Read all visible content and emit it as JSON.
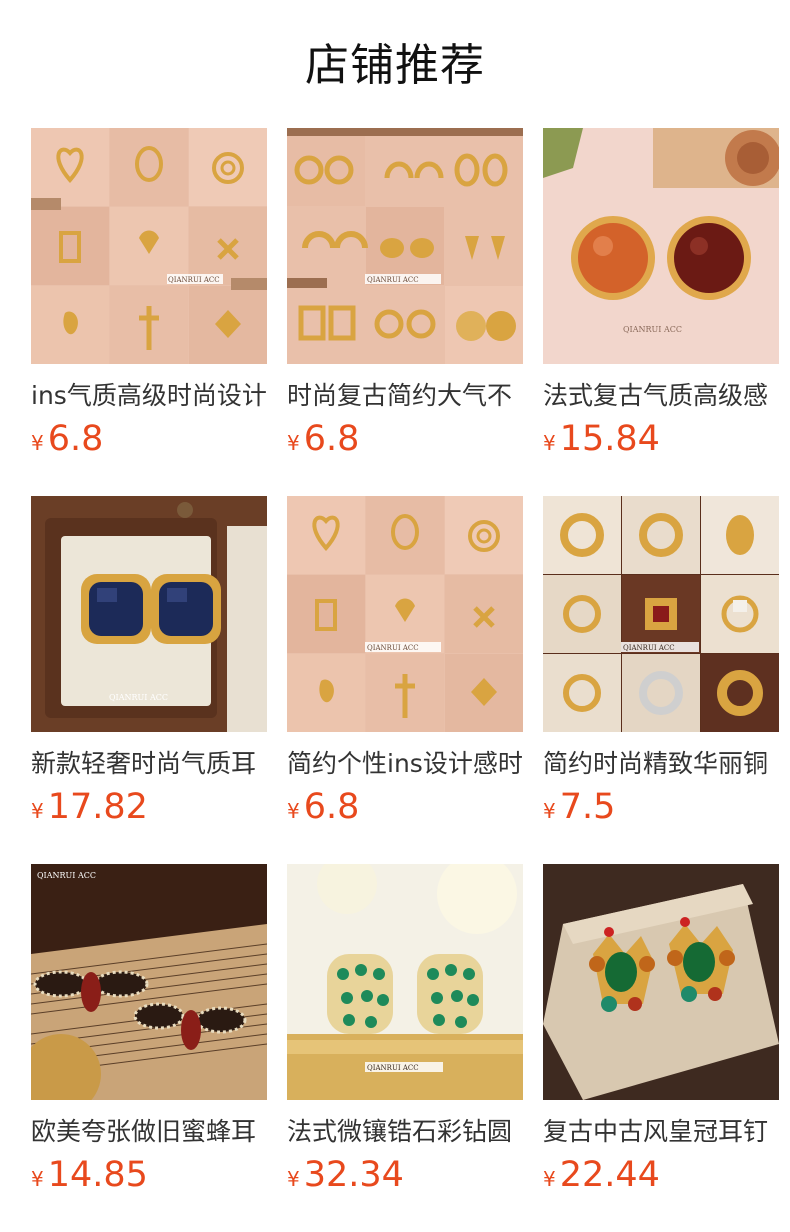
{
  "section": {
    "title": "店铺推荐"
  },
  "theme": {
    "price_color": "#e8491d"
  },
  "products": [
    {
      "name": "ins气质高级时尚设计",
      "currency": "¥",
      "price": "6.8",
      "image": "gold-pendant-necklaces-grid",
      "brand": "QIANRUI ACC"
    },
    {
      "name": "时尚复古简约大气不",
      "currency": "¥",
      "price": "6.8",
      "image": "gold-hoop-earrings-grid",
      "brand": "QIANRUI ACC"
    },
    {
      "name": "法式复古气质高级感",
      "currency": "¥",
      "price": "15.84",
      "image": "amber-garnet-stud-earrings",
      "brand": "QIANRUI ACC"
    },
    {
      "name": "新款轻奢时尚气质耳",
      "currency": "¥",
      "price": "17.82",
      "image": "sapphire-earrings-jewelry-box",
      "brand": "QIANRUI ACC"
    },
    {
      "name": "简约个性ins设计感时",
      "currency": "¥",
      "price": "6.8",
      "image": "gold-pendant-necklaces-grid",
      "brand": "QIANRUI ACC"
    },
    {
      "name": "简约时尚精致华丽铜",
      "currency": "¥",
      "price": "7.5",
      "image": "gold-rings-grid",
      "brand": "QIANRUI ACC"
    },
    {
      "name": "欧美夸张做旧蜜蜂耳",
      "currency": "¥",
      "price": "14.85",
      "image": "bee-earrings-sheet-music",
      "brand": "QIANRUI ACC"
    },
    {
      "name": "法式微镶锆石彩钻圆",
      "currency": "¥",
      "price": "32.34",
      "image": "emerald-hoop-earrings",
      "brand": "QIANRUI ACC"
    },
    {
      "name": "复古中古风皇冠耳钉",
      "currency": "¥",
      "price": "22.44",
      "image": "crown-gem-earrings",
      "brand": ""
    }
  ]
}
